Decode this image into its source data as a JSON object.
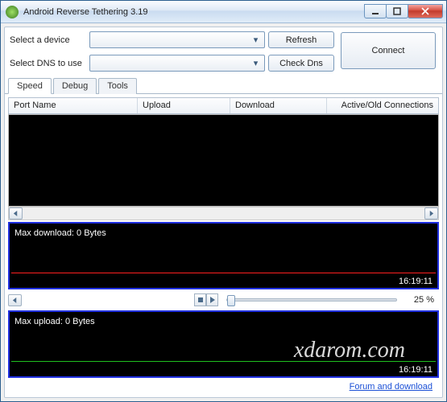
{
  "window": {
    "title": "Android Reverse Tethering 3.19"
  },
  "form": {
    "device_label": "Select a device",
    "dns_label": "Select DNS to use",
    "refresh": "Refresh",
    "checkdns": "Check Dns",
    "connect": "Connect"
  },
  "tabs": {
    "speed": "Speed",
    "debug": "Debug",
    "tools": "Tools"
  },
  "columns": {
    "port": "Port Name",
    "upload": "Upload",
    "download": "Download",
    "conn": "Active/Old Connections"
  },
  "chart_down": {
    "label": "Max download: 0 Bytes",
    "time": "16:19:11"
  },
  "chart_up": {
    "label": "Max upload: 0 Bytes",
    "time": "16:19:11"
  },
  "slider": {
    "percent": "25 %"
  },
  "watermark": "xdarom.com",
  "footer": {
    "link": "Forum and download"
  }
}
